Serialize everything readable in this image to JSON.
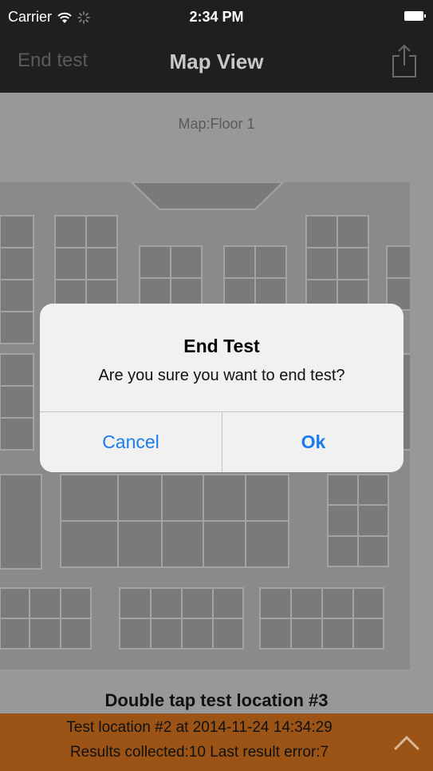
{
  "status_bar": {
    "carrier": "Carrier",
    "time": "2:34 PM"
  },
  "nav": {
    "left_button": "End test",
    "title": "Map View",
    "right_icon": "share-icon"
  },
  "map": {
    "label": "Map:Floor 1"
  },
  "instruction": "Double tap test location #3",
  "info_bar": {
    "line1": "Test location #2 at 2014-11-24 14:34:29",
    "line2": "Results collected:10   Last result error:7",
    "toggle_icon": "chevron-up-icon",
    "background": "#9b5316"
  },
  "alert": {
    "title": "End Test",
    "message": "Are you sure you want to end test?",
    "cancel_label": "Cancel",
    "ok_label": "Ok",
    "button_color": "#1b7cf2"
  }
}
